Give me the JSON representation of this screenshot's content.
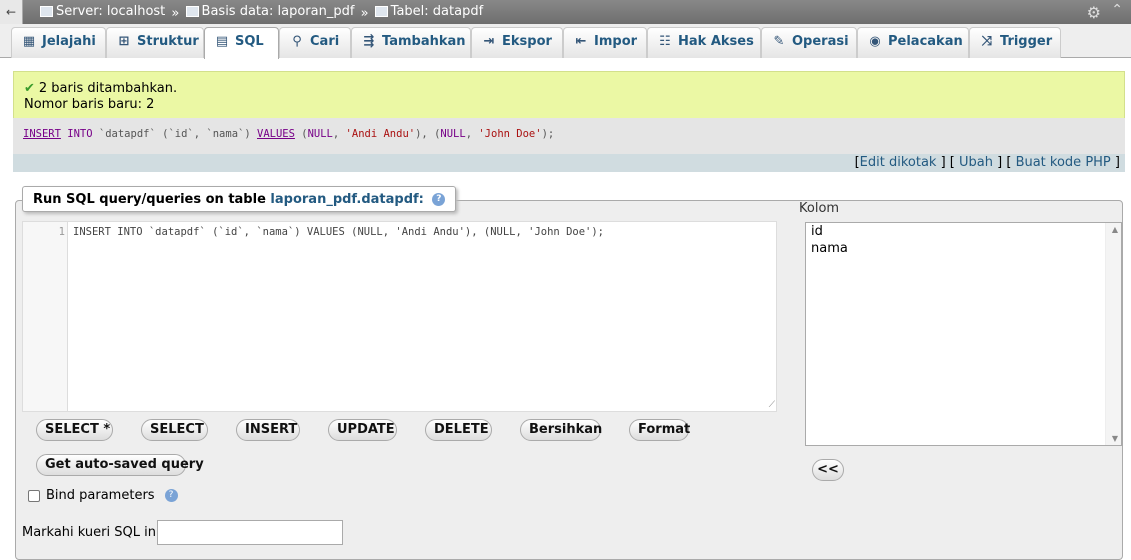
{
  "breadcrumb": {
    "back": "←",
    "server": "Server: localhost",
    "database": "Basis data: laporan_pdf",
    "table": "Tabel: datapdf",
    "separator": "»"
  },
  "tabs": [
    {
      "label": "Jelajahi",
      "icon": "table-icon"
    },
    {
      "label": "Struktur",
      "icon": "structure-icon"
    },
    {
      "label": "SQL",
      "icon": "sql-icon"
    },
    {
      "label": "Cari",
      "icon": "search-icon"
    },
    {
      "label": "Tambahkan",
      "icon": "insert-icon"
    },
    {
      "label": "Ekspor",
      "icon": "export-icon"
    },
    {
      "label": "Impor",
      "icon": "import-icon"
    },
    {
      "label": "Hak Akses",
      "icon": "privileges-icon"
    },
    {
      "label": "Operasi",
      "icon": "wrench-icon"
    },
    {
      "label": "Pelacakan",
      "icon": "eye-icon"
    },
    {
      "label": "Trigger",
      "icon": "trigger-icon"
    }
  ],
  "message": {
    "line1": "2 baris ditambahkan.",
    "line2": "Nomor baris baru: 2"
  },
  "executed_query": {
    "p1": "INSERT",
    "p2": "INTO",
    "p3": "`datapdf`",
    "p4": "(",
    "p5": "`id`",
    "p6": ",",
    "p7": "`nama`",
    "p8": ")",
    "p9": "VALUES",
    "p10": "(",
    "p11": "NULL",
    "p12": ",",
    "p13": "'Andi Andu'",
    "p14": "),",
    "p15": "(",
    "p16": "NULL",
    "p17": ",",
    "p18": "'John Doe'",
    "p19": ");"
  },
  "query_links": {
    "open1": "[",
    "edit": "Edit dikotak",
    "mid1": "] [",
    "change": "Ubah",
    "mid2": "] [",
    "php": "Buat kode PHP",
    "close": "]"
  },
  "sql_panel": {
    "legend_prefix": "Run SQL query/queries on table",
    "legend_table": "laporan_pdf.datapdf:",
    "line_number": "1",
    "code": "INSERT INTO `datapdf` (`id`, `nama`) VALUES (NULL, 'Andi Andu'), (NULL, 'John Doe');"
  },
  "buttons": {
    "select_all": "SELECT *",
    "select": "SELECT",
    "insert": "INSERT",
    "update": "UPDATE",
    "delete": "DELETE",
    "clear": "Bersihkan",
    "format": "Format",
    "autosaved": "Get auto-saved query",
    "insert_column": "<<"
  },
  "bind_parameters": "Bind parameters",
  "bookmark_label": "Markahi kueri SQL ini:",
  "columns": {
    "label": "Kolom",
    "items": [
      "id",
      "nama"
    ]
  }
}
